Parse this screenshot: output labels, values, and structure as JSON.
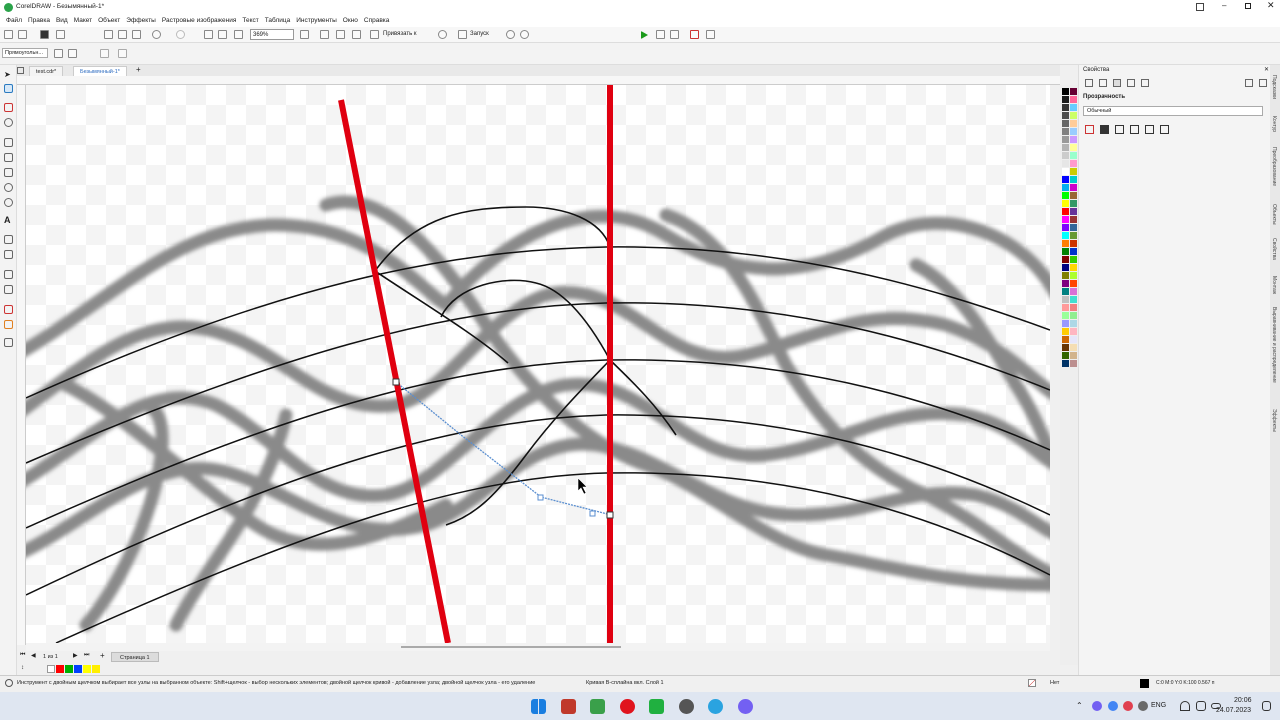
{
  "app": {
    "title": "CorelDRAW - Безымянный-1*",
    "menu": [
      "Файл",
      "Правка",
      "Вид",
      "Макет",
      "Объект",
      "Эффекты",
      "Растровые изображения",
      "Текст",
      "Таблица",
      "Инструменты",
      "Окно",
      "Справка"
    ]
  },
  "toolbar": {
    "zoom": "369%",
    "snap_label": "Привязать к",
    "launch_label": "Запуск"
  },
  "propbar": {
    "preset": "Прямоугольн..."
  },
  "tabs": [
    {
      "label": "test.cdr*",
      "active": false
    },
    {
      "label": "Безымянный-1*",
      "active": true
    }
  ],
  "page": {
    "nav": "1 из 1",
    "tab": "Страница 1"
  },
  "props": {
    "header": "Свойства",
    "section": "Прозрачность",
    "mode": "Обычный"
  },
  "side_tabs": [
    "Подсказки",
    "Контур",
    "Преобразование",
    "Объекты",
    "Свойства",
    "Монтаж",
    "Выравнивание и распределение",
    "Эффекты"
  ],
  "status": {
    "hint": "Инструмент с двойным щелчком выбирает все узлы на выбранном объекте: Shift+щелчок - выбор нескольких элементов; двойной щелчок кривой - добавление узла; двойной щелчок узла - его удаление",
    "object": "Кривая B-сплайна вкл. Слой 1",
    "fill": "Нет",
    "outline": "C:0 M:0 Y:0 K:100  0.567 п"
  },
  "taskbar": {
    "lang": "ENG",
    "time": "20:06",
    "date": "24.07.2023"
  },
  "colors": {
    "red_guide": "#e00010",
    "braid": "#8a8a8a",
    "selection": "#5b8fd0"
  },
  "palette_colors": [
    "#000000",
    "#1a1a1a",
    "#333333",
    "#4d4d4d",
    "#666666",
    "#808080",
    "#999999",
    "#b3b3b3",
    "#cccccc",
    "#e6e6e6",
    "#ffffff",
    "#0000ff",
    "#00aeef",
    "#00ff00",
    "#ffff00",
    "#ff0000",
    "#ff00ff",
    "#7f00ff",
    "#00ffff",
    "#ff7f00",
    "#008000",
    "#800000",
    "#000080",
    "#808000",
    "#800080",
    "#008080",
    "#c0c0c0",
    "#ff9999",
    "#99ff99",
    "#9999ff",
    "#ffcc00",
    "#cc6600",
    "#663300",
    "#336600",
    "#003366",
    "#660033",
    "#ff6699",
    "#66ccff",
    "#ccff66",
    "#ffcc99",
    "#99ccff",
    "#cc99ff",
    "#ffff99",
    "#99ffcc",
    "#ff99cc",
    "#cccc00",
    "#00cccc",
    "#cc00cc",
    "#996633",
    "#339966",
    "#663399",
    "#993333",
    "#336699",
    "#669933",
    "#cc3300",
    "#0033cc",
    "#33cc00",
    "#ffd700",
    "#adff2f",
    "#ff4500",
    "#da70d6",
    "#40e0d0",
    "#f08080",
    "#90ee90",
    "#add8e6",
    "#ffb6c1",
    "#e6e6fa",
    "#f5deb3",
    "#d2b48c",
    "#bc8f8f"
  ]
}
